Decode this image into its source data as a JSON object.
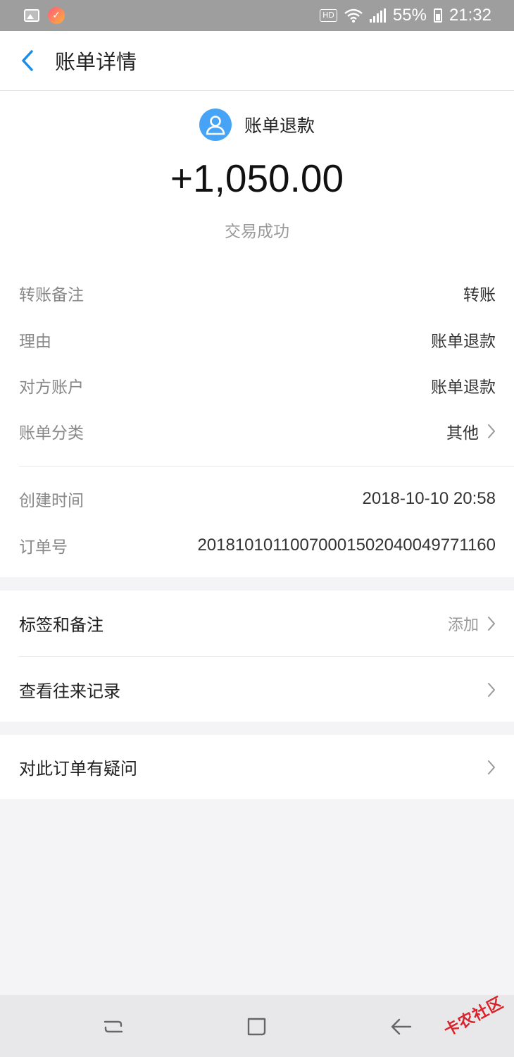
{
  "status_bar": {
    "badge": "HD",
    "battery": "55%",
    "time": "21:32",
    "icons": [
      "gallery-icon",
      "app-notification-icon",
      "wifi-icon",
      "cellular-signal-icon",
      "battery-icon"
    ]
  },
  "nav": {
    "title": "账单详情",
    "back_icon": "chevron-left-icon"
  },
  "header": {
    "avatar_icon": "user-avatar-icon",
    "counterparty": "账单退款",
    "amount": "+1,050.00",
    "status": "交易成功"
  },
  "details": [
    {
      "label": "转账备注",
      "value": "转账"
    },
    {
      "label": "理由",
      "value": "账单退款"
    },
    {
      "label": "对方账户",
      "value": "账单退款"
    },
    {
      "label": "账单分类",
      "value": "其他"
    }
  ],
  "meta": [
    {
      "label": "创建时间",
      "value": "2018-10-10 20:58"
    },
    {
      "label": "订单号",
      "value": "20181010110070001502040049771160"
    }
  ],
  "actions": [
    {
      "label": "标签和备注",
      "hint": "添加"
    },
    {
      "label": "查看往来记录",
      "hint": ""
    }
  ],
  "help": {
    "label": "对此订单有疑问"
  },
  "watermark": "卡农社区",
  "colors": {
    "accent": "#1a8de9",
    "avatar": "#46a3f5",
    "background": "#f4f4f6",
    "status_bar": "#9e9e9e"
  }
}
